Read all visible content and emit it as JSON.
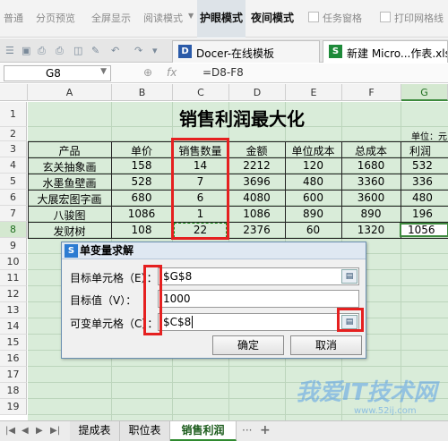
{
  "ribbon": {
    "normal": "普通",
    "page_break": "分页预览",
    "fullscreen": "全屏显示",
    "reading": "阅读模式",
    "eye": "护眼模式",
    "night": "夜间模式",
    "task_pane": "任务窗格",
    "print_grid": "打印网格线"
  },
  "tabs": {
    "docer": "Docer-在线模板",
    "workbook": "新建 Micro...作表.xlsx"
  },
  "formula_bar": {
    "cell_ref": "G8",
    "fx": "fx",
    "formula": "=D8-F8"
  },
  "columns": [
    "A",
    "B",
    "C",
    "D",
    "E",
    "F",
    "G"
  ],
  "rows": [
    "1",
    "2",
    "3",
    "4",
    "5",
    "6",
    "7",
    "8",
    "9",
    "10",
    "11",
    "12",
    "13",
    "14",
    "15",
    "16",
    "17",
    "18",
    "19"
  ],
  "sheet": {
    "title": "销售利润最大化",
    "unit": "单位：元",
    "headers": [
      "产品",
      "单价",
      "销售数量",
      "金额",
      "单位成本",
      "总成本",
      "利润"
    ],
    "data": [
      [
        "玄关抽象画",
        "158",
        "14",
        "2212",
        "120",
        "1680",
        "532"
      ],
      [
        "水墨鱼壁画",
        "528",
        "7",
        "3696",
        "480",
        "3360",
        "336"
      ],
      [
        "大展宏图字画",
        "680",
        "6",
        "4080",
        "600",
        "3600",
        "480"
      ],
      [
        "八骏图",
        "1086",
        "1",
        "1086",
        "890",
        "890",
        "196"
      ],
      [
        "发财树",
        "108",
        "22",
        "2376",
        "60",
        "1320",
        "1056"
      ]
    ]
  },
  "dialog": {
    "title": "单变量求解",
    "target_label": "目标单元格（E）：",
    "target_value": "$G$8",
    "goal_label": "目标值（V）：",
    "goal_value": "1000",
    "var_label": "可变单元格（C）：",
    "var_value": "$C$8",
    "ok": "确定",
    "cancel": "取消"
  },
  "sheet_tabs": [
    "提成表",
    "职位表",
    "销售利润"
  ],
  "watermark": {
    "text": "我爱IT技术网",
    "url": "www.52ij.com"
  },
  "colors": {
    "grid_bg": "#d9ecd9",
    "highlight": "#e52020",
    "selected": "#3d8a3d"
  }
}
